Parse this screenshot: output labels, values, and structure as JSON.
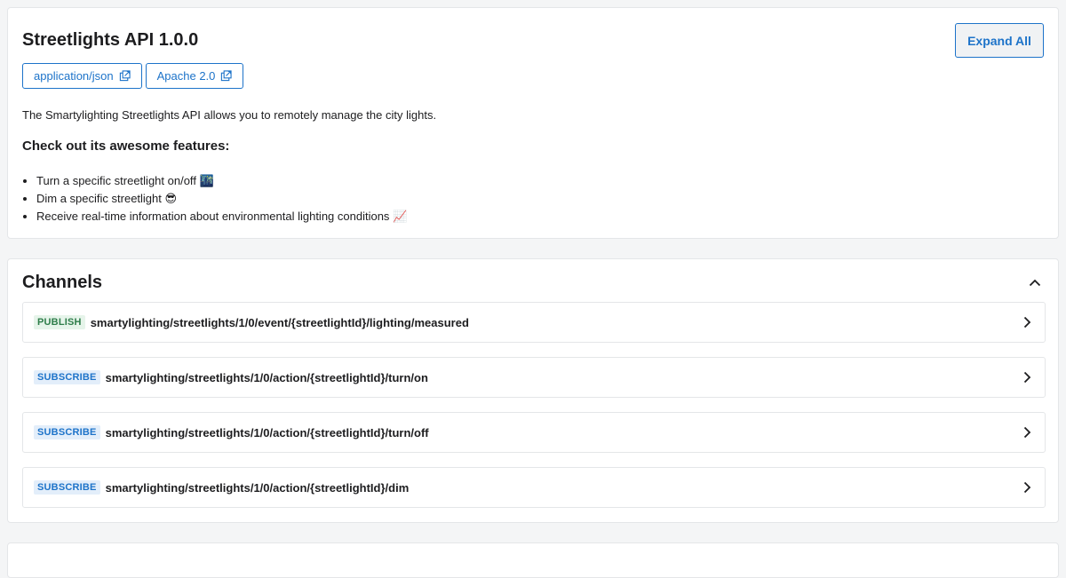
{
  "info": {
    "title": "Streetlights API 1.0.0",
    "expand_all_label": "Expand All",
    "links": [
      {
        "label": "application/json",
        "icon": "external-link-icon"
      },
      {
        "label": "Apache 2.0",
        "icon": "external-link-icon"
      }
    ],
    "description": "The Smartylighting Streetlights API allows you to remotely manage the city lights.",
    "features_heading": "Check out its awesome features:",
    "features": [
      "Turn a specific streetlight on/off 🌃",
      "Dim a specific streetlight 😎",
      "Receive real-time information about environmental lighting conditions 📈"
    ]
  },
  "channels": {
    "title": "Channels",
    "collapse_icon": "chevron-up-icon",
    "items": [
      {
        "operation": "PUBLISH",
        "path": "smartylighting/streetlights/1/0/event/{streetlightId}/lighting/measured"
      },
      {
        "operation": "SUBSCRIBE",
        "path": "smartylighting/streetlights/1/0/action/{streetlightId}/turn/on"
      },
      {
        "operation": "SUBSCRIBE",
        "path": "smartylighting/streetlights/1/0/action/{streetlightId}/turn/off"
      },
      {
        "operation": "SUBSCRIBE",
        "path": "smartylighting/streetlights/1/0/action/{streetlightId}/dim"
      }
    ]
  },
  "colors": {
    "accent": "#1d73c9",
    "publish_badge_bg": "#e6f4ea",
    "publish_badge_text": "#2e7d4a",
    "subscribe_badge_bg": "#e3eefa",
    "subscribe_badge_text": "#1d73c9",
    "page_bg": "#f4f5f6"
  }
}
